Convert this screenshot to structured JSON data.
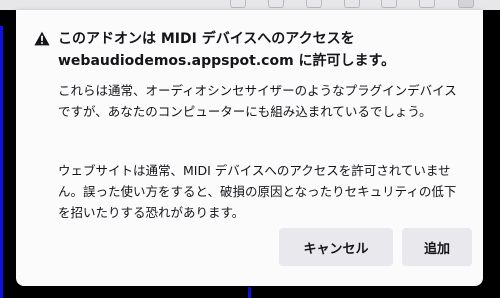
{
  "dialog": {
    "title": "このアドオンは MIDI デバイスへのアクセスを webaudiodemos.appspot.com に許可します。",
    "paragraph_1": "これらは通常、オーディオシンセサイザーのようなプラグインデバイスですが、あなたのコンピューターにも組み込まれているでしょう。",
    "paragraph_2": "ウェブサイトは通常、MIDI デバイスへのアクセスを許可されていません。誤った使い方をすると、破損の原因となったりセキュリティの低下を招いたりする恐れがあります。",
    "icon": "warning-icon",
    "buttons": {
      "cancel_label": "キャンセル",
      "add_label": "追加"
    }
  },
  "colors": {
    "panel_background": "#fbfbfc",
    "button_background": "#e9e9ed",
    "text": "#15141a",
    "page_accent": "#1010e0"
  }
}
